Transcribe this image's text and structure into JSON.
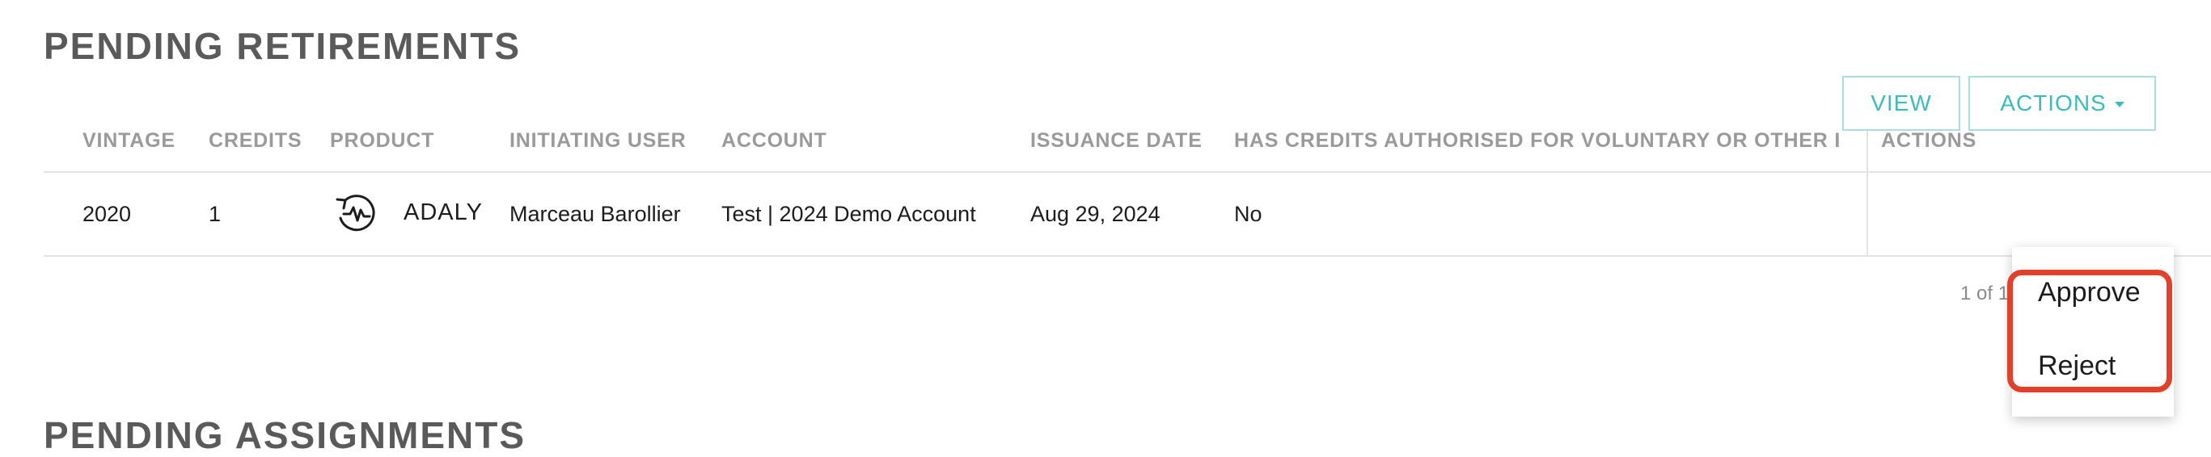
{
  "retirements_section": {
    "title": "PENDING RETIREMENTS"
  },
  "assignments_section": {
    "title": "PENDING ASSIGNMENTS"
  },
  "table": {
    "headers": {
      "vintage": "VINTAGE",
      "credits": "CREDITS",
      "product": "PRODUCT",
      "initiating_user": "INITIATING USER",
      "account": "ACCOUNT",
      "issuance_date": "ISSUANCE DATE",
      "authorised": "HAS CREDITS AUTHORISED FOR VOLUNTARY OR OTHER I",
      "actions": "ACTIONS"
    },
    "rows": [
      {
        "vintage": "2020",
        "credits": "1",
        "product_icon": "product-logo-icon",
        "product": "ADALY",
        "initiating_user": "Marceau Barollier",
        "account": "Test | 2024 Demo Account",
        "issuance_date": "Aug 29, 2024",
        "authorised": "No",
        "view_label": "VIEW",
        "actions_label": "ACTIONS"
      }
    ]
  },
  "pagination": {
    "text": "1 of 1"
  },
  "actions_menu": {
    "items": [
      {
        "label": "Approve"
      },
      {
        "label": "Reject"
      }
    ]
  },
  "colors": {
    "accent": "#3bbcbc",
    "highlight": "#e2402a",
    "header_text": "#9a9a9a",
    "title_text": "#5a5a5a"
  }
}
